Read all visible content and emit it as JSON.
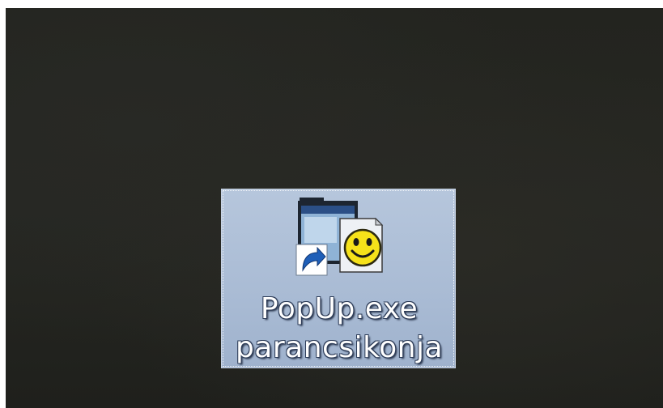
{
  "desktop": {
    "icons": [
      {
        "icon": "smiley-shortcut-icon",
        "label_line1": "PopUp.exe",
        "label_line2": "parancsikonja",
        "selected": true
      }
    ]
  },
  "colors": {
    "desktop_background": "#23241f",
    "selection_fill": "#aebfd7",
    "label_text": "#ffffff"
  }
}
